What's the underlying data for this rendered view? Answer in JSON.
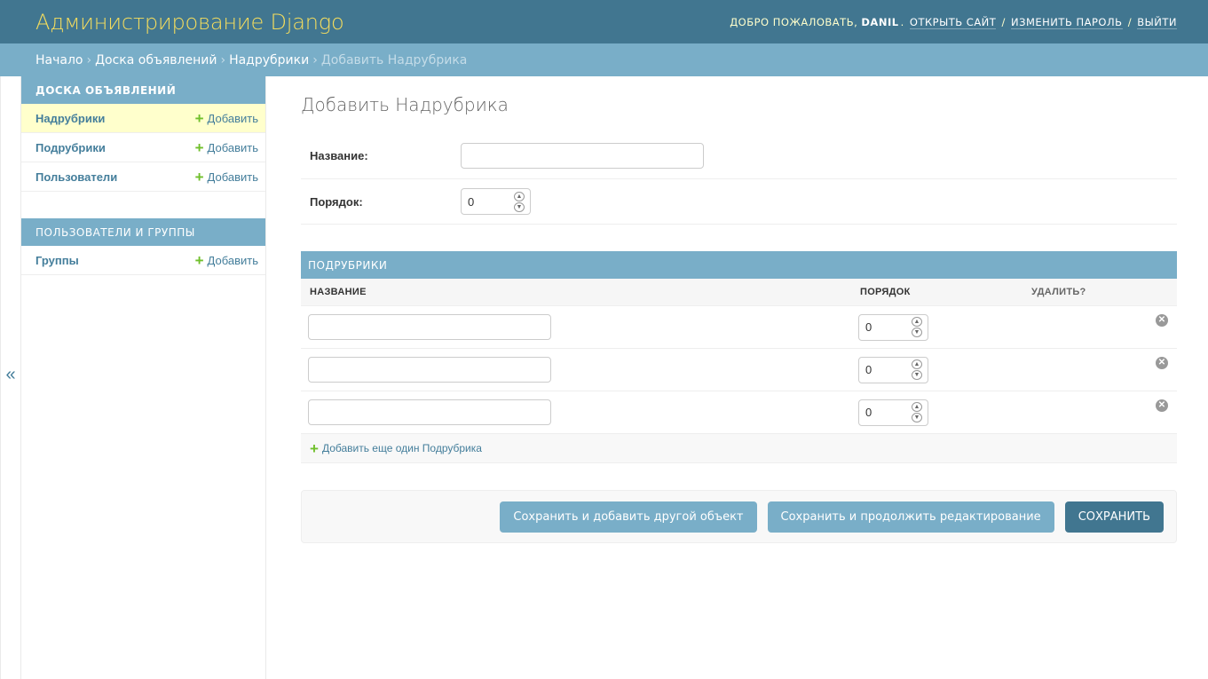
{
  "header": {
    "branding": "Администрирование Django",
    "welcome": "ДОБРО ПОЖАЛОВАТЬ,",
    "username": "DANIL",
    "view_site": "ОТКРЫТЬ САЙТ",
    "change_password": "ИЗМЕНИТЬ ПАРОЛЬ",
    "logout": "ВЫЙТИ"
  },
  "breadcrumbs": {
    "home": "Начало",
    "app": "Доска объявлений",
    "model": "Надрубрики",
    "current": "Добавить Надрубрика",
    "separator": "›"
  },
  "sidebar": {
    "toggle": "«",
    "modules": [
      {
        "caption": "Доска объявлений",
        "items": [
          {
            "label": "Надрубрики",
            "add": "Добавить"
          },
          {
            "label": "Подрубрики",
            "add": "Добавить"
          },
          {
            "label": "Пользователи",
            "add": "Добавить"
          }
        ]
      },
      {
        "caption": "Пользователи и группы",
        "items": [
          {
            "label": "Группы",
            "add": "Добавить"
          }
        ]
      }
    ]
  },
  "form": {
    "title": "Добавить Надрубрика",
    "name_label": "Название:",
    "name_value": "",
    "order_label": "Порядок:",
    "order_value": "0"
  },
  "inline": {
    "caption": "Подрубрики",
    "col_name": "Название",
    "col_order": "Порядок",
    "col_delete": "Удалить?",
    "rows": [
      {
        "name": "",
        "order": "0"
      },
      {
        "name": "",
        "order": "0"
      },
      {
        "name": "",
        "order": "0"
      }
    ],
    "add_another": "Добавить еще один Подрубрика"
  },
  "submit": {
    "save_add": "Сохранить и добавить другой объект",
    "save_continue": "Сохранить и продолжить редактирование",
    "save": "Сохранить"
  },
  "colors": {
    "header": "#417690",
    "breadcrumbs": "#79aec8",
    "branding": "#f5dd5d",
    "link": "#447e9b",
    "add_plus": "#70bf2b",
    "current_row": "#ffffcc"
  }
}
